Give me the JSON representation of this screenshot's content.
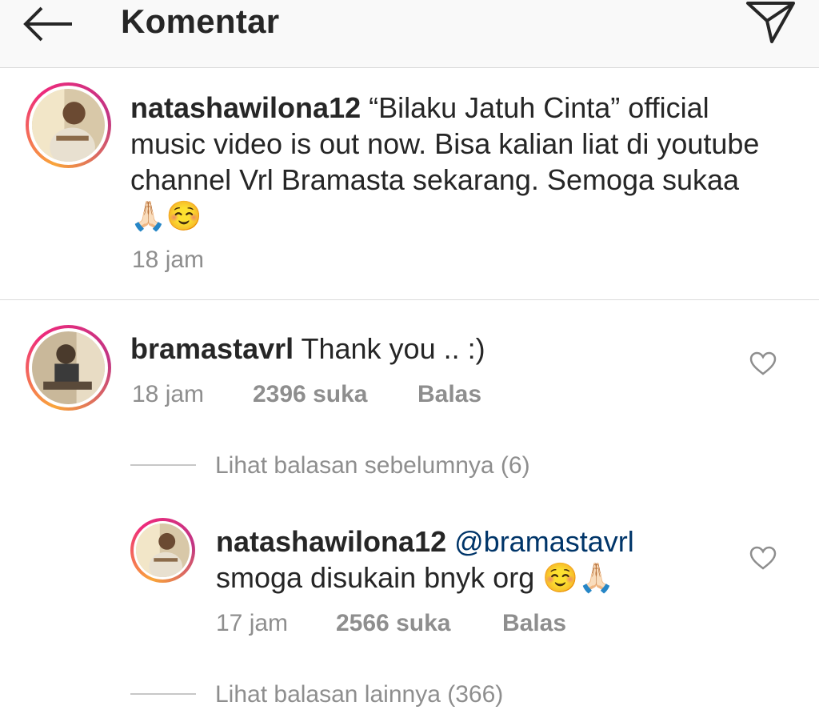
{
  "header": {
    "title": "Komentar",
    "back_icon": "arrow-left-icon",
    "share_icon": "paper-plane-icon"
  },
  "caption": {
    "username": "natashawilona12",
    "text": "“Bilaku Jatuh Cinta” official music video is out now. Bisa kalian liat di youtube channel Vrl Bramasta sekarang. Semoga sukaa 🙏🏻☺️",
    "time": "18 jam"
  },
  "comments": [
    {
      "username": "bramastavrl",
      "text": "Thank you .. :)",
      "time": "18 jam",
      "likes": "2396 suka",
      "reply": "Balas",
      "view_replies": "Lihat balasan sebelumnya (6)",
      "replies": [
        {
          "username": "natashawilona12",
          "mention": "@bramastavrl",
          "text": "smoga disukain bnyk org ☺️🙏🏻",
          "time": "17 jam",
          "likes": "2566 suka",
          "reply": "Balas"
        }
      ],
      "view_more": "Lihat balasan lainnya (366)"
    }
  ],
  "colors": {
    "text": "#262626",
    "secondary": "#8e8e8e",
    "mention": "#003569",
    "divider": "#dbdbdb",
    "story_ring_start": "#f9a53a",
    "story_ring_end": "#c13584"
  }
}
